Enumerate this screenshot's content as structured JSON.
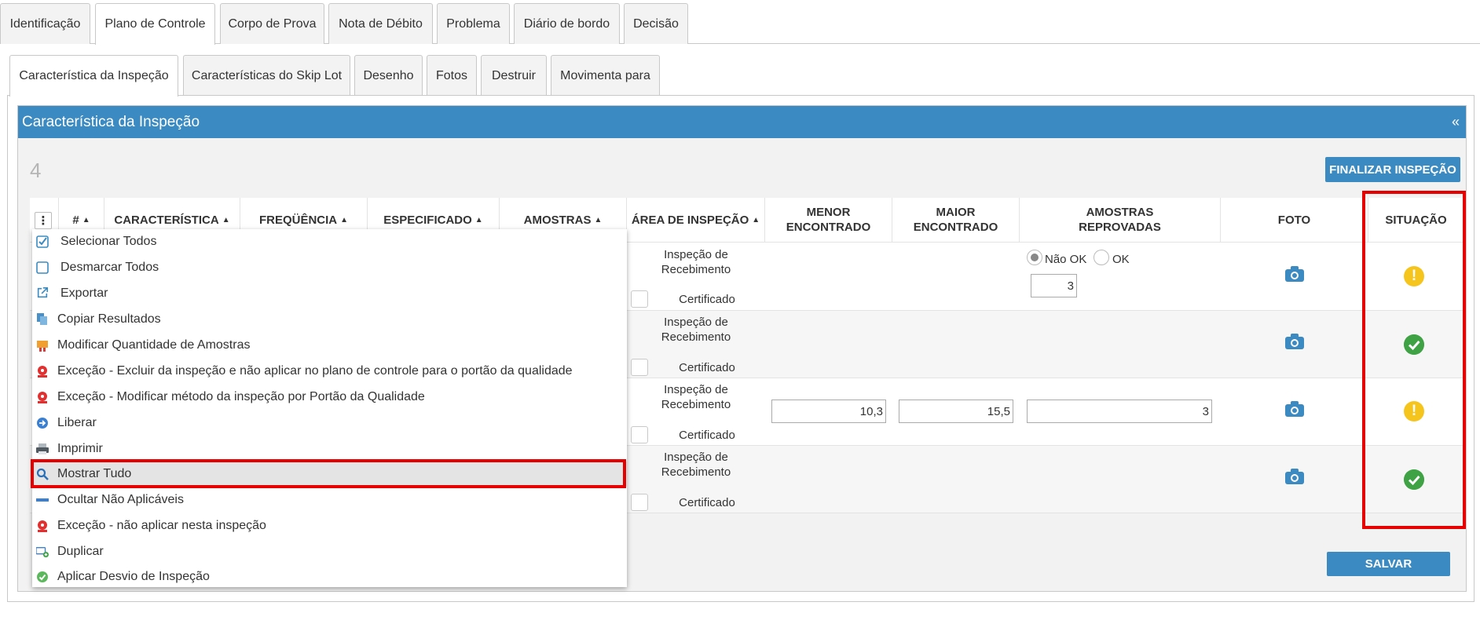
{
  "top_tabs": [
    "Identificação",
    "Plano de Controle",
    "Corpo de Prova",
    "Nota de Débito",
    "Problema",
    "Diário de bordo",
    "Decisão"
  ],
  "sub_tabs": [
    "Característica da Inspeção",
    "Características do Skip Lot",
    "Desenho",
    "Fotos",
    "Destruir",
    "Movimenta para"
  ],
  "panel": {
    "title": "Característica da Inspeção",
    "collapse_glyph": "«"
  },
  "count": "4",
  "buttons": {
    "finalize": "FINALIZAR INSPEÇÃO",
    "save": "SALVAR"
  },
  "table": {
    "columns": {
      "menu": "⋮",
      "num": "#",
      "caracteristica": "CARACTERÍSTICA",
      "frequencia": "FREQÜÊNCIA",
      "especificado": "ESPECIFICADO",
      "amostras": "AMOSTRAS",
      "area": "ÁREA DE INSPEÇÃO",
      "menor_1": "MENOR",
      "menor_2": "ENCONTRADO",
      "maior_1": "MAIOR",
      "maior_2": "ENCONTRADO",
      "reprov_1": "AMOSTRAS",
      "reprov_2": "REPROVADAS",
      "foto": "FOTO",
      "situacao": "SITUAÇÃO"
    },
    "rows": [
      {
        "area_1": "Inspeção de",
        "area_2": "Recebimento",
        "cert": "Certificado",
        "radio_nok": "Não OK",
        "radio_ok": "OK",
        "reprov": "3",
        "status": "warning"
      },
      {
        "area_1": "Inspeção de",
        "area_2": "Recebimento",
        "cert": "Certificado",
        "status": "ok"
      },
      {
        "area_1": "Inspeção de",
        "area_2": "Recebimento",
        "cert": "Certificado",
        "menor": "10,3",
        "maior": "15,5",
        "reprov": "3",
        "status": "warning"
      },
      {
        "area_1": "Inspeção de",
        "area_2": "Recebimento",
        "cert": "Certificado",
        "status": "ok"
      }
    ]
  },
  "menu": {
    "items": [
      {
        "label": "Selecionar Todos",
        "icon": "checked-box-icon"
      },
      {
        "label": "Desmarcar Todos",
        "icon": "empty-box-icon"
      },
      {
        "label": "Exportar",
        "icon": "export-icon"
      },
      {
        "label": "Copiar Resultados",
        "icon": "copy-icon"
      },
      {
        "label": "Modificar Quantidade de Amostras",
        "icon": "samples-icon"
      },
      {
        "label": "Exceção - Excluir da inspeção e não aplicar no plano de controle para o portão da qualidade",
        "icon": "exception-icon"
      },
      {
        "label": "Exceção - Modificar método da inspeção por Portão da Qualidade",
        "icon": "exception-icon"
      },
      {
        "label": "Liberar",
        "icon": "release-icon"
      },
      {
        "label": "Imprimir",
        "icon": "printer-icon"
      },
      {
        "label": "Mostrar Tudo",
        "icon": "search-icon"
      },
      {
        "label": "Ocultar Não Aplicáveis",
        "icon": "minus-icon"
      },
      {
        "label": "Exceção - não aplicar nesta inspeção",
        "icon": "exception-icon"
      },
      {
        "label": "Duplicar",
        "icon": "duplicate-icon"
      },
      {
        "label": "Aplicar Desvio de Inspeção",
        "icon": "check-circle-icon"
      }
    ]
  },
  "colors": {
    "accent": "#3b8bc2",
    "highlight": "#e60000",
    "warning": "#f6c51d",
    "success": "#3fa346"
  }
}
